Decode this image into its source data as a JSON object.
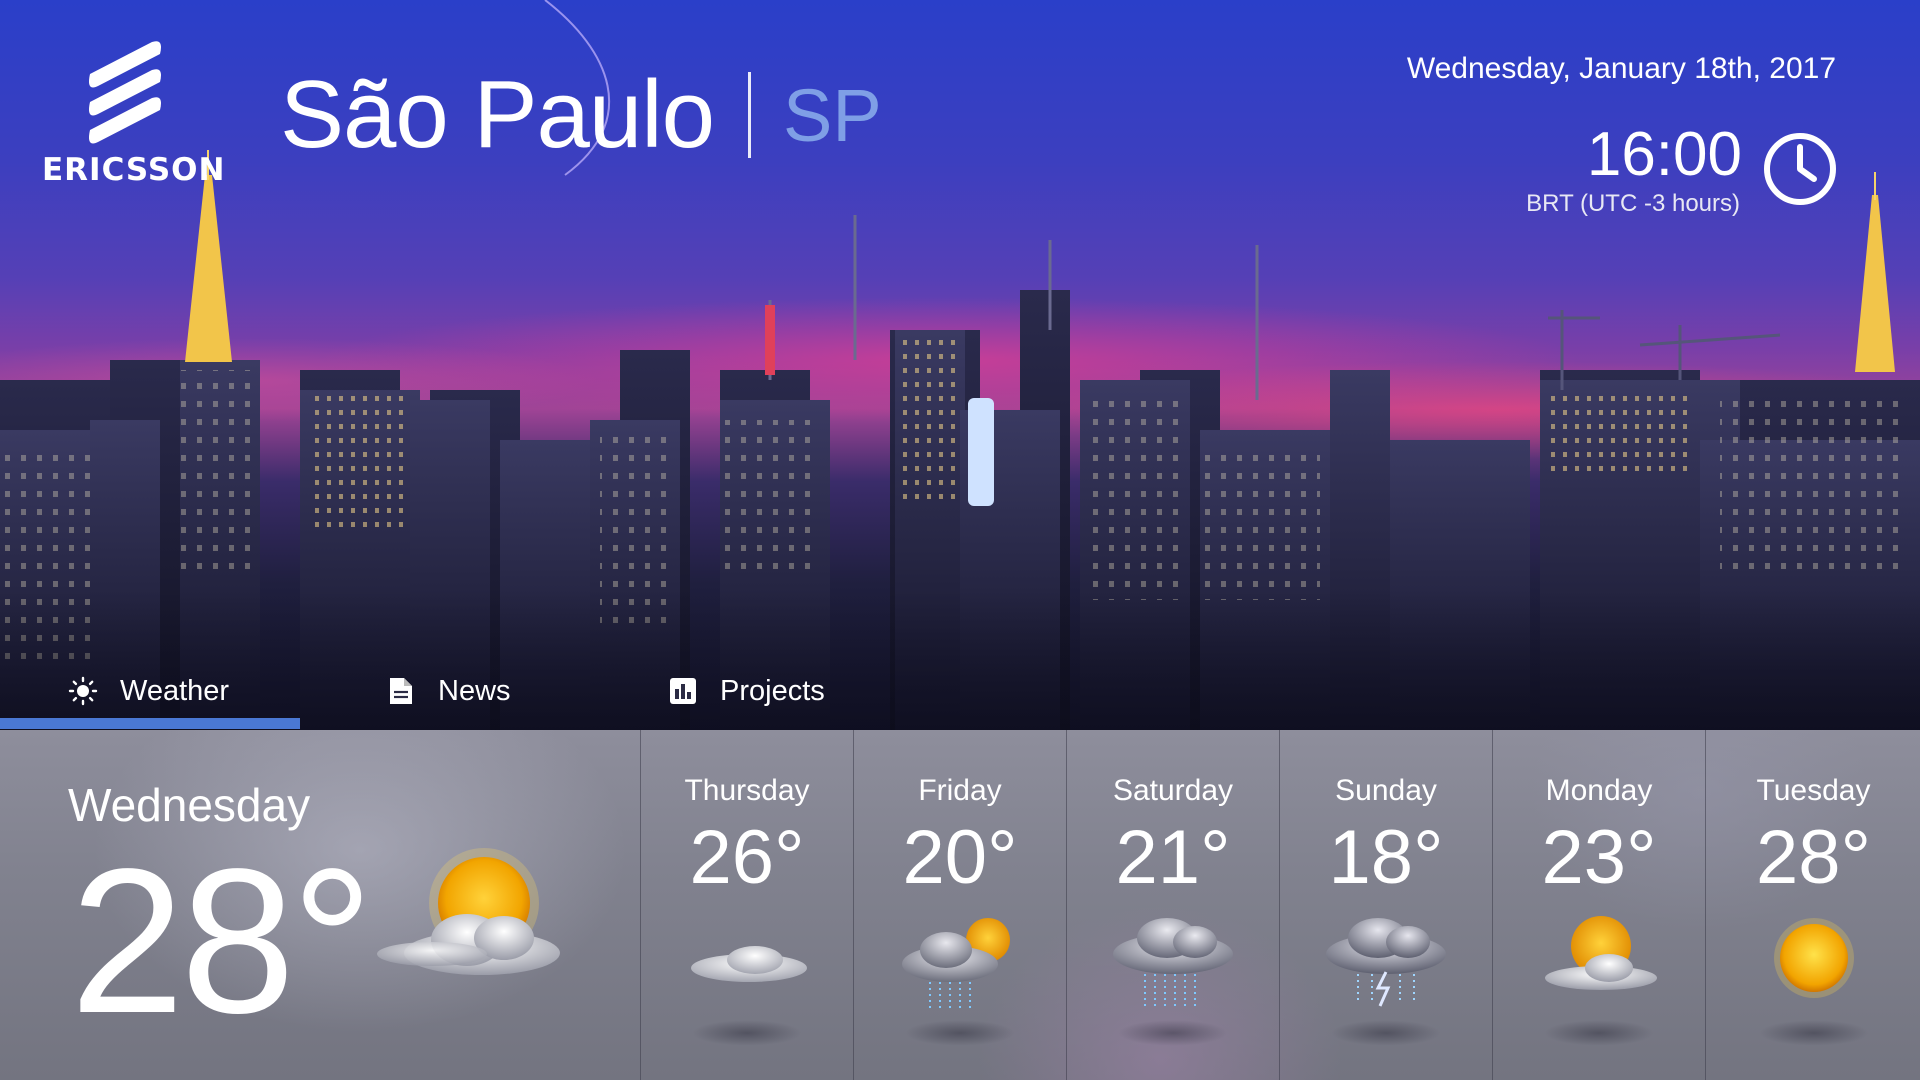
{
  "brand": {
    "name": "ERICSSON"
  },
  "city": {
    "name": "São Paulo",
    "state": "SP"
  },
  "datetime": {
    "date": "Wednesday, January 18th, 2017",
    "time": "16:00",
    "timezone": "BRT (UTC -3 hours)"
  },
  "tabs": [
    {
      "label": "Weather",
      "icon": "sun-icon",
      "active": true
    },
    {
      "label": "News",
      "icon": "document-icon",
      "active": false
    },
    {
      "label": "Projects",
      "icon": "bar-chart-icon",
      "active": false
    }
  ],
  "today": {
    "day": "Wednesday",
    "temp": "28°",
    "condition_icon": "partly-cloudy-icon"
  },
  "forecast": [
    {
      "day": "Thursday",
      "temp": "26°",
      "condition_icon": "cloud-icon"
    },
    {
      "day": "Friday",
      "temp": "20°",
      "condition_icon": "sun-rain-icon"
    },
    {
      "day": "Saturday",
      "temp": "21°",
      "condition_icon": "rain-icon"
    },
    {
      "day": "Sunday",
      "temp": "18°",
      "condition_icon": "thunderstorm-icon"
    },
    {
      "day": "Monday",
      "temp": "23°",
      "condition_icon": "partly-cloudy-icon"
    },
    {
      "day": "Tuesday",
      "temp": "28°",
      "condition_icon": "sun-icon"
    }
  ],
  "colors": {
    "accent": "#4a78d4",
    "state_text": "#7f9fe6",
    "panel": "#85868f"
  }
}
